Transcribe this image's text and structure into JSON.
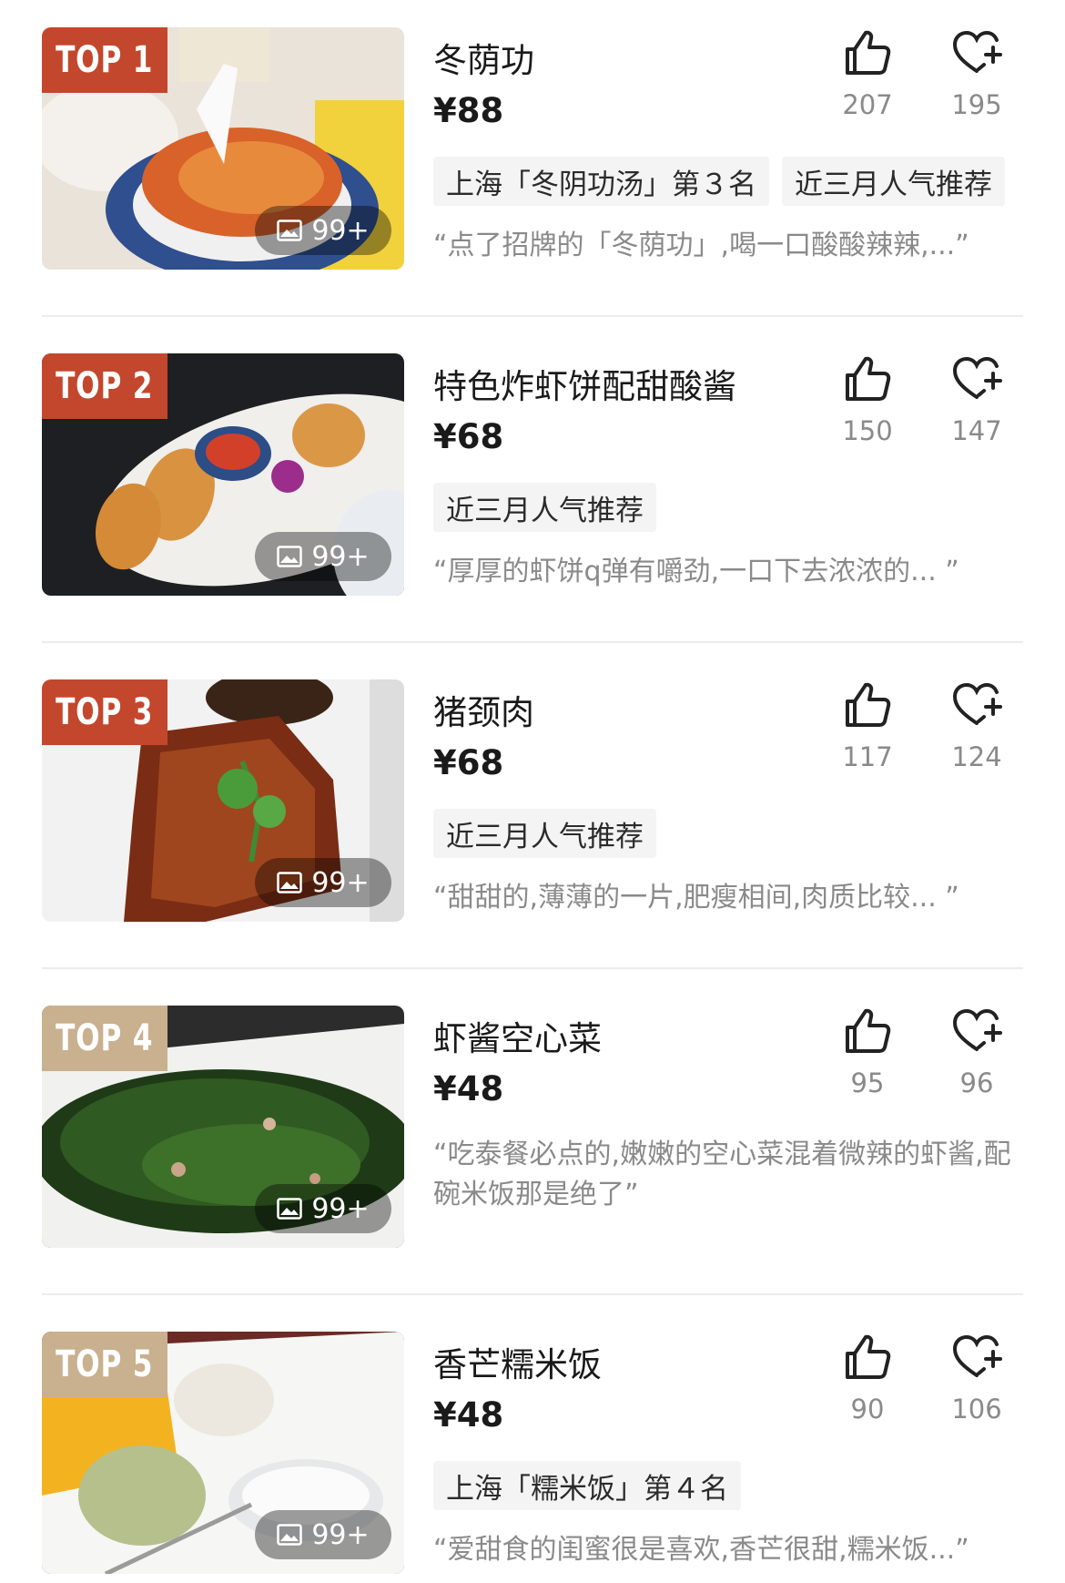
{
  "items": [
    {
      "badge": "TOP 1",
      "badge_style": "hot",
      "name": "冬荫功",
      "price": "¥88",
      "likes": "207",
      "favorites": "195",
      "photo_count": "99+",
      "tags": [
        "上海「冬阴功汤」第３名",
        "近三月人气推荐"
      ],
      "review": "“点了招牌的「冬荫功」,喝一口酸酸辣辣,...”"
    },
    {
      "badge": "TOP 2",
      "badge_style": "hot",
      "name": "特色炸虾饼配甜酸酱",
      "price": "¥68",
      "likes": "150",
      "favorites": "147",
      "photo_count": "99+",
      "tags": [
        "近三月人气推荐"
      ],
      "review": "“厚厚的虾饼q弹有嚼劲,一口下去浓浓的...   ”"
    },
    {
      "badge": "TOP 3",
      "badge_style": "hot",
      "name": "猪颈肉",
      "price": "¥68",
      "likes": "117",
      "favorites": "124",
      "photo_count": "99+",
      "tags": [
        "近三月人气推荐"
      ],
      "review": "“甜甜的,薄薄的一片,肥瘦相间,肉质比较...   ”"
    },
    {
      "badge": "TOP 4",
      "badge_style": "cold",
      "name": "虾酱空心菜",
      "price": "¥48",
      "likes": "95",
      "favorites": "96",
      "photo_count": "99+",
      "tags": [],
      "review": "“吃泰餐必点的,嫩嫩的空心菜混着微辣的虾酱,配碗米饭那是绝了”"
    },
    {
      "badge": "TOP 5",
      "badge_style": "cold",
      "name": "香芒糯米饭",
      "price": "¥48",
      "likes": "90",
      "favorites": "106",
      "photo_count": "99+",
      "tags": [
        "上海「糯米饭」第４名"
      ],
      "review": "“爱甜食的闺蜜很是喜欢,香芒很甜,糯米饭...”"
    }
  ]
}
